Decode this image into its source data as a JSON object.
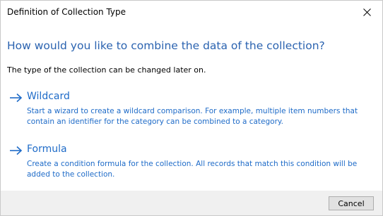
{
  "window": {
    "title": "Definition of Collection Type"
  },
  "heading": "How would you like to combine the data of the collection?",
  "subtext": "The type of the collection can be changed later on.",
  "options": [
    {
      "title": "Wildcard",
      "description": "Start a wizard to create a wildcard comparison. For example, multiple item numbers that contain an identifier for the category can be combined to a category.",
      "icon": "arrow-right-icon"
    },
    {
      "title": "Formula",
      "description": "Create a condition formula for the collection. All records that match this condition will be added to the collection.",
      "icon": "arrow-right-icon"
    }
  ],
  "footer": {
    "cancel_label": "Cancel"
  },
  "colors": {
    "accent": "#1e6bc8",
    "heading": "#2b63b0",
    "footer_bg": "#f0f0f0"
  }
}
